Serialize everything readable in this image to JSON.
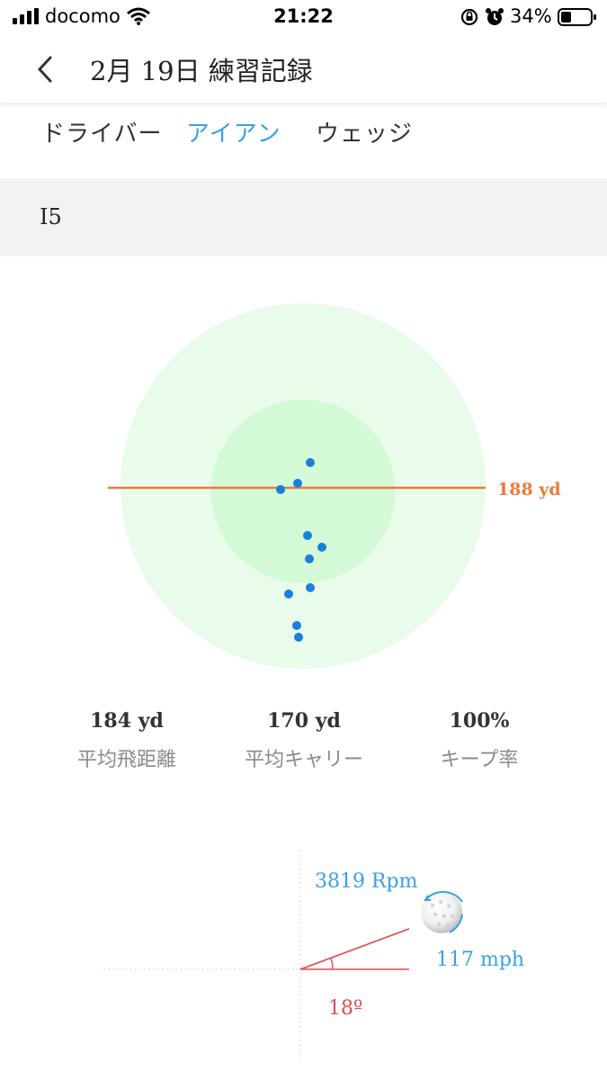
{
  "status": {
    "carrier": "docomo",
    "time": "21:22",
    "battery": "34%"
  },
  "header": {
    "title": "2月 19日 練習記録"
  },
  "tabs": [
    {
      "label": "ドライバー",
      "active": false
    },
    {
      "label": "アイアン",
      "active": true
    },
    {
      "label": "ウェッジ",
      "active": false
    }
  ],
  "club": "I5",
  "target_chart": {
    "distance_label": "188 yd",
    "shot_dot_count": 10,
    "colors": {
      "outer_ring": "#e9fbea",
      "inner_ring": "#d3f9d6",
      "shot": "#1a7fdc",
      "target_line": "#ef7a3b"
    }
  },
  "stats": [
    {
      "value": "184 yd",
      "label": "平均飛距離"
    },
    {
      "value": "170 yd",
      "label": "平均キャリー"
    },
    {
      "value": "100%",
      "label": "キープ率"
    }
  ],
  "launch": {
    "spin": "3819 Rpm",
    "speed": "117 mph",
    "angle": "18º",
    "colors": {
      "spin_text": "#3ba0e6",
      "angle_line": "#e8484a"
    }
  },
  "icons": [
    "signal-icon",
    "wifi-icon",
    "rotation-lock-icon",
    "alarm-icon",
    "battery-icon",
    "back-chevron-icon",
    "golf-ball-icon"
  ]
}
